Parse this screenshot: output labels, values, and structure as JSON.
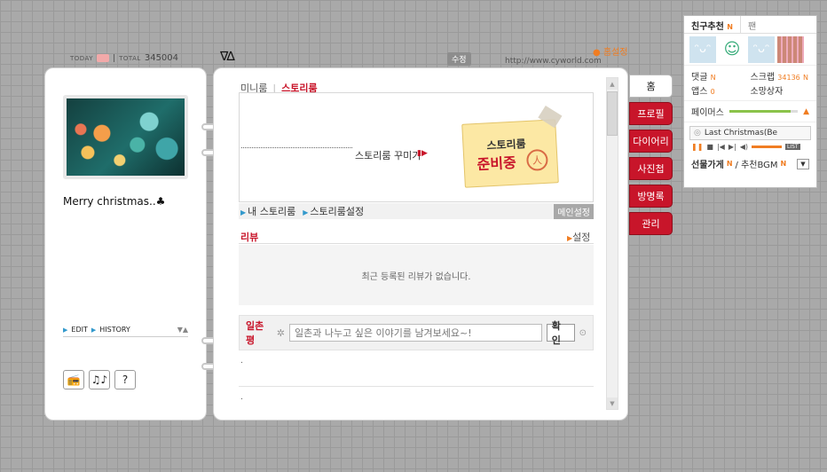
{
  "header": {
    "today_label": "TODAY",
    "separator": "|",
    "total_label": "TOTAL",
    "total_value": "345004",
    "arrows": "∇∆",
    "edit_tag": "수정",
    "url": "http://www.cyworld.com",
    "home_setting": "● 홈설정"
  },
  "profile": {
    "motto": "Merry christmas..♣",
    "edit_label": "EDIT",
    "history_label": "HISTORY",
    "btn_radio": "📻",
    "btn_music": "♫♪",
    "btn_help": "?"
  },
  "main": {
    "tab_miniroom": "미니룸",
    "tab_sep": "|",
    "tab_storyroom": "스토리룸",
    "deco_label": "스토리룸 꾸미기",
    "note_line1": "스토리룸",
    "note_line2": "준비중",
    "stamp": "人",
    "link_my_story": "내 스토리룸",
    "link_story_setting": "스토리룸설정",
    "main_setting": "메인설정",
    "review_title": "리뷰",
    "review_setting": "설정",
    "review_empty": "최근 등록된 리뷰가 없습니다.",
    "guest_label": "일촌평",
    "guest_placeholder": "일촌과 나누고 싶은 이야기를 남겨보세요~!",
    "guest_ok": "확인",
    "dot1": ".",
    "dot2": "."
  },
  "menu": {
    "items": [
      "홈",
      "프로필",
      "다이어리",
      "사진첩",
      "방명록",
      "관리"
    ],
    "active_index": 0
  },
  "widget": {
    "tab_friends": "친구추천",
    "tab_new": "N",
    "tab_other": "팬",
    "comments": "댓글",
    "scrap": "스크랩",
    "scrap_count": "34136",
    "apps": "앱스",
    "apps_count": "0",
    "wish": "소망상자",
    "pace_label": "페이머스",
    "pace_level": 0.9,
    "song": "Last Christmas(Be",
    "list_label": "LIST",
    "gift_label": "선물가게",
    "bgm_label": "/ 추천BGM"
  },
  "colors": {
    "accent_red": "#c8152a",
    "accent_orange": "#f07d22",
    "link_blue": "#3399cc"
  }
}
